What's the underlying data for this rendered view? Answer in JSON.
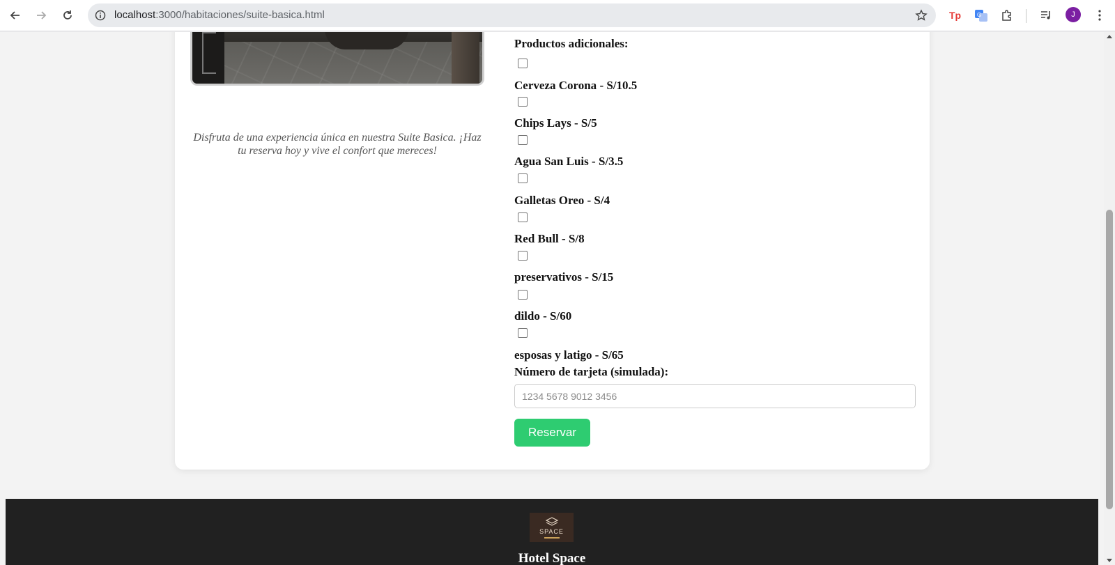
{
  "browser": {
    "url_host": "localhost",
    "url_path": ":3000/habitaciones/suite-basica.html",
    "avatar_initial": "J"
  },
  "page": {
    "caption": "Disfruta de una experiencia única en nuestra Suite Basica. ¡Haz tu reserva hoy y vive el confort que mereces!",
    "products_heading": "Productos adicionales:",
    "products": [
      {
        "name": "Cerveza Corona",
        "price": " - S/10.5",
        "checked": false
      },
      {
        "name": "Chips Lays",
        "price": " - S/5",
        "checked": false
      },
      {
        "name": "Agua San Luis",
        "price": " - S/3.5",
        "checked": false
      },
      {
        "name": "Galletas Oreo",
        "price": " - S/4",
        "checked": false
      },
      {
        "name": "Red Bull",
        "price": " - S/8",
        "checked": false
      },
      {
        "name": "preservativos",
        "price": " - S/15",
        "checked": false
      },
      {
        "name": "dildo",
        "price": " - S/60",
        "checked": false
      },
      {
        "name": "esposas y latigo",
        "price": " - S/65",
        "checked": false
      }
    ],
    "card_label": "Número de tarjeta (simulada):",
    "card_placeholder": "1234 5678 9012 3456",
    "card_value": "",
    "reserve_label": "Reservar",
    "accent_color": "#2ecc71"
  },
  "footer": {
    "logo_text": "SPACE",
    "hotel_name": "Hotel Space"
  }
}
